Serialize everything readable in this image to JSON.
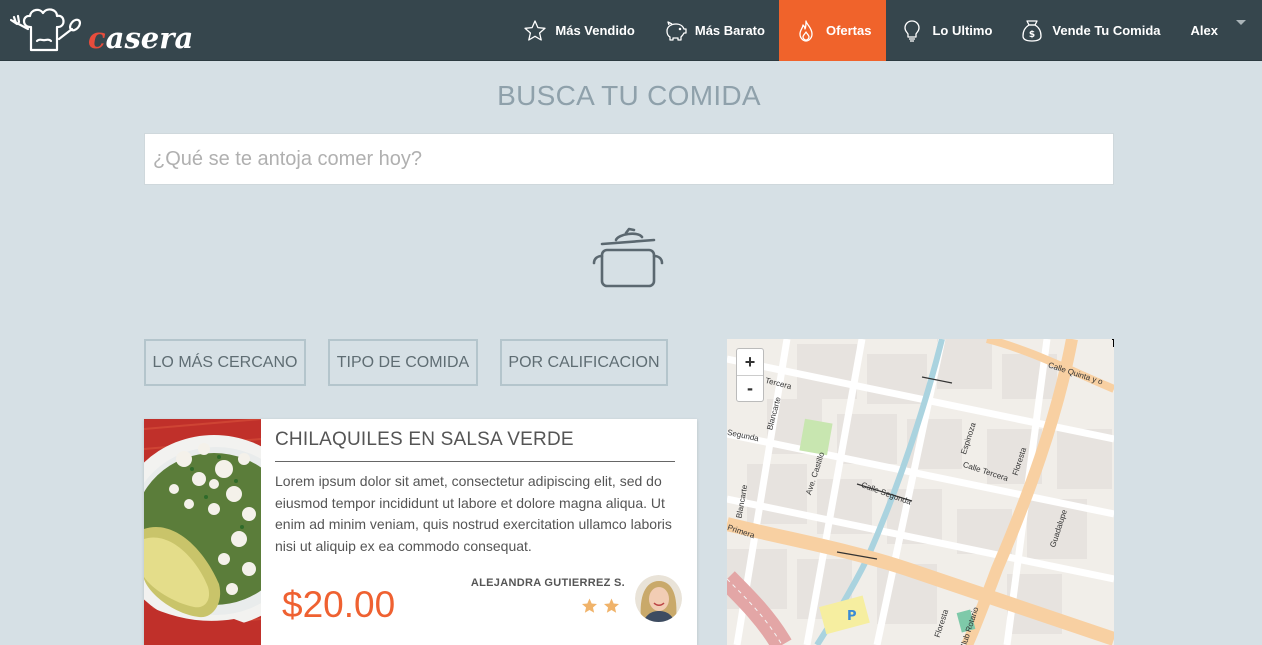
{
  "brand": {
    "name_first": "c",
    "name_rest": "asera"
  },
  "nav": {
    "items": [
      {
        "label": "Más Vendido",
        "icon": "star-icon"
      },
      {
        "label": "Más Barato",
        "icon": "piggy-bank-icon"
      },
      {
        "label": "Ofertas",
        "icon": "flame-icon",
        "active": true
      },
      {
        "label": "Lo Ultimo",
        "icon": "lightbulb-icon"
      },
      {
        "label": "Vende Tu Comida",
        "icon": "money-bag-icon"
      }
    ],
    "user": "Alex"
  },
  "hero": {
    "title": "BUSCA TU COMIDA",
    "search_placeholder": "¿Qué se te antoja comer hoy?"
  },
  "filters": [
    "LO MÁS CERCANO",
    "TIPO DE COMIDA",
    "POR CALIFICACION"
  ],
  "card": {
    "title": "CHILAQUILES EN SALSA VERDE",
    "description": "Lorem ipsum dolor sit amet, consectetur adipiscing elit, sed do eiusmod tempor incididunt ut labore et dolore magna aliqua. Ut enim ad minim veniam, quis nostrud exercitation ullamco laboris nisi ut aliquip ex ea commodo consequat.",
    "price": "$20.00",
    "author": "ALEJANDRA GUTIERREZ S.",
    "rating": 2
  },
  "map": {
    "zoom_in": "+",
    "zoom_out": "-",
    "streets": [
      "Calle Quinta y o",
      "Tercera",
      "Blancarte",
      "Segunda",
      "Espinoza",
      "Calle Tercera",
      "Floresta",
      "Ave. Castillo",
      "Calle Segunda",
      "Guadalupe",
      "Blancarte",
      "Primera",
      "Floresta",
      "Club Rotario"
    ]
  },
  "colors": {
    "nav_bg": "#36464d",
    "accent": "#f0632b",
    "page_bg": "#d6e0e5"
  }
}
